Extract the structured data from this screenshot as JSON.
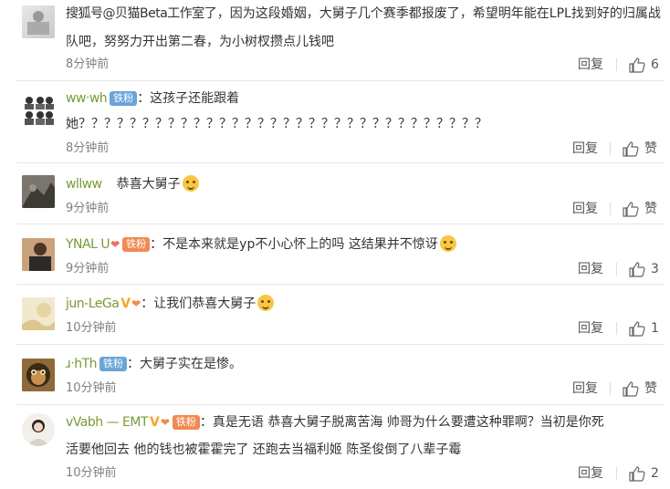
{
  "comments": [
    {
      "username": "搜狐号@贝猫Beta工作室",
      "text_line1": "了，因为这段婚姻，大舅子几个赛季都报废了，希望明年能在LPL找到好的归属战",
      "text_line2": "队吧，努努力开出第二春，为小树杈攒点儿钱吧",
      "time": "8分钟前",
      "reply_label": "回复",
      "likes": "6"
    },
    {
      "username": "ww‧wh",
      "badge": "铁粉",
      "text_line1": "：这孩子还能跟着",
      "text_line2": "她？？？？？？？？？？？？？？？？？？？？？？？？？？？？？？？？",
      "time": "8分钟前",
      "reply_label": "回复",
      "likes": "赞"
    },
    {
      "username": "wllww",
      "text_line1": "恭喜大舅子",
      "time": "9分钟前",
      "reply_label": "回复",
      "likes": "赞"
    },
    {
      "username": "YNAL U",
      "badge": "铁粉",
      "text_line1": "：不是本来就是yp不小心怀上的吗 这结果并不惊讶",
      "time": "9分钟前",
      "reply_label": "回复",
      "likes": "3"
    },
    {
      "username": "jun-LeGa",
      "text_line1": "：让我们恭喜大舅子",
      "time": "10分钟前",
      "reply_label": "回复",
      "likes": "1"
    },
    {
      "username": "ɹ‧hTh",
      "badge": "铁粉",
      "text_line1": "：大舅子实在是惨。",
      "time": "10分钟前",
      "reply_label": "回复",
      "likes": "赞"
    },
    {
      "username": "vVabh — EMT",
      "badge": "铁粉",
      "text_line1": "：真是无语 恭喜大舅子脱离苦海 帅哥为什么要遭这种罪啊？当初是你死",
      "text_line2": "活要他回去 他的钱也被霍霍完了 还跑去当福利姬 陈圣俊倒了八辈子霉",
      "time": "10分钟前",
      "reply_label": "回复",
      "likes": "2"
    }
  ]
}
